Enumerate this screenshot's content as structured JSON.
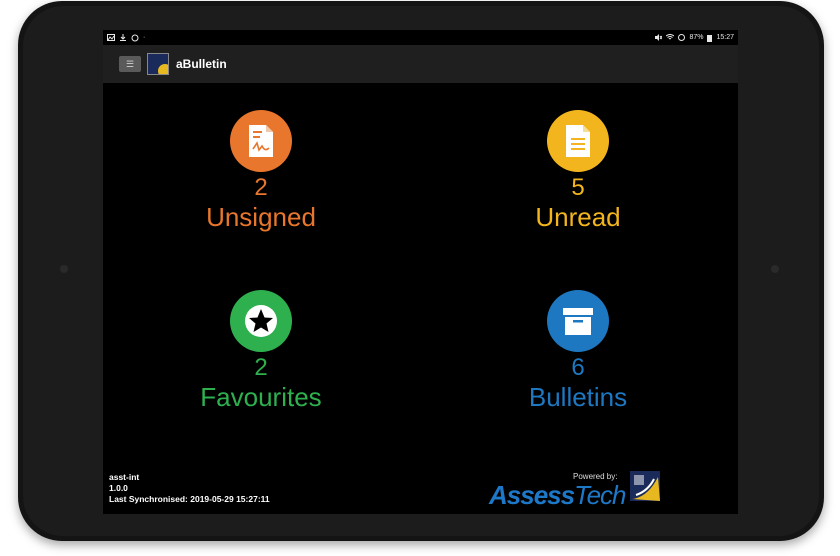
{
  "statusbar": {
    "battery": "87%",
    "time": "15:27"
  },
  "appbar": {
    "title": "aBulletin",
    "menu_icon": "hamburger-icon"
  },
  "tiles": [
    {
      "count": "2",
      "label": "Unsigned",
      "color": "#e8762c",
      "icon": "signed-document-icon"
    },
    {
      "count": "5",
      "label": "Unread",
      "color": "#f2b51d",
      "icon": "document-icon"
    },
    {
      "count": "2",
      "label": "Favourites",
      "color": "#2eb04f",
      "icon": "star-icon"
    },
    {
      "count": "6",
      "label": "Bulletins",
      "color": "#1d78c1",
      "icon": "archive-box-icon"
    }
  ],
  "footer": {
    "env": "asst-int",
    "version": "1.0.0",
    "last_sync": "Last Synchronised: 2019-05-29 15:27:11",
    "powered_by": "Powered by:",
    "brand_assess": "Assess",
    "brand_tech": "Tech"
  }
}
